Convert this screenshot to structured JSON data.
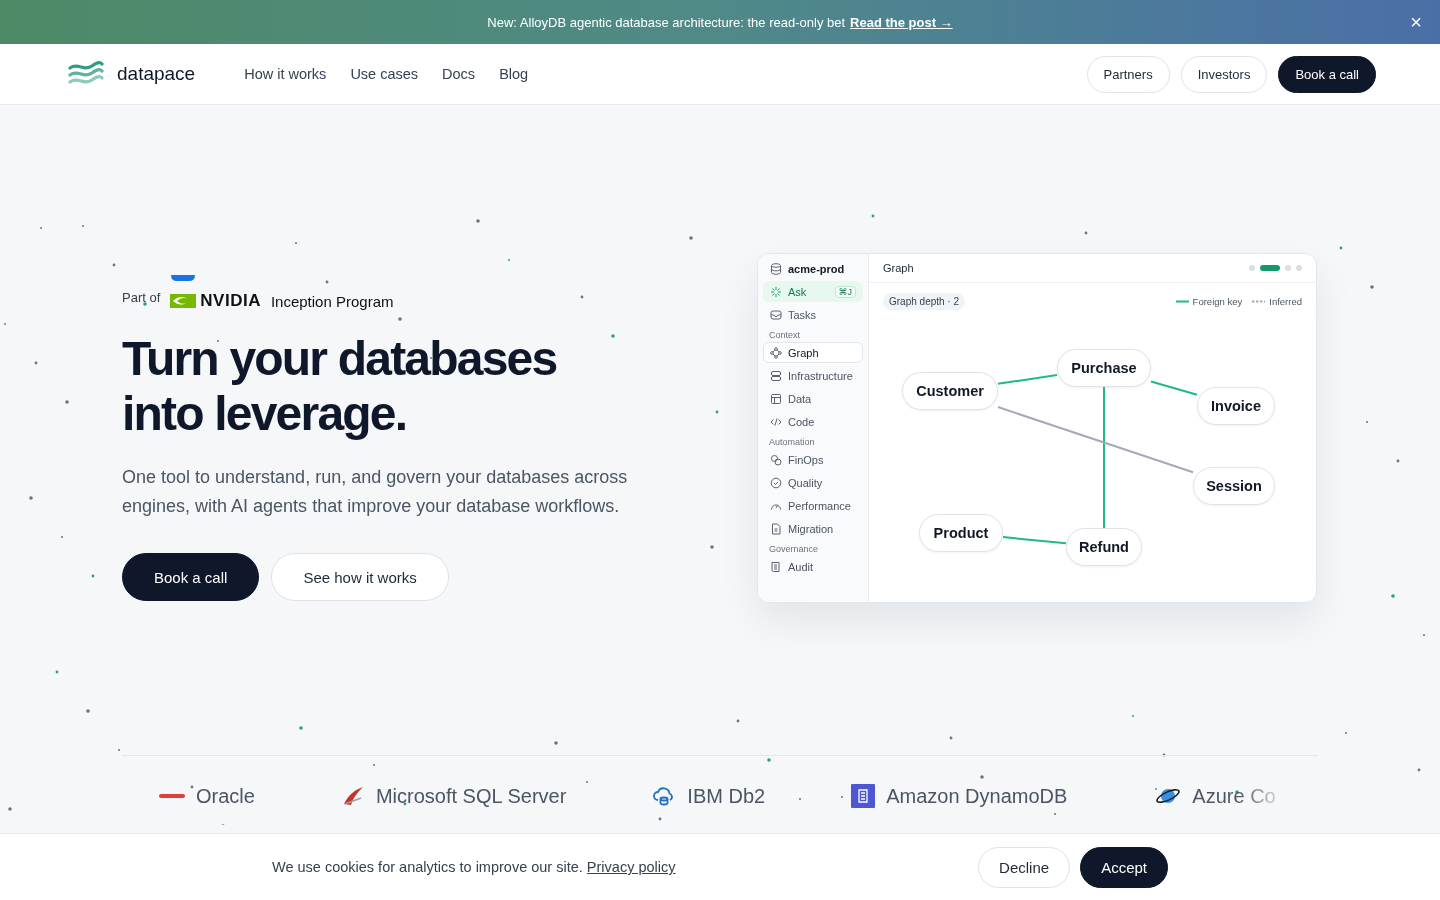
{
  "announcement": {
    "text": "New: AlloyDB agentic database architecture: the read-only bet",
    "link": "Read the post",
    "arrow": "→",
    "close": "×"
  },
  "nav": {
    "brand": "datapace",
    "links": [
      "How it works",
      "Use cases",
      "Docs",
      "Blog"
    ],
    "buttons": [
      {
        "label": "Partners",
        "kind": "outline"
      },
      {
        "label": "Investors",
        "kind": "outline"
      },
      {
        "label": "Book a call",
        "kind": "primary"
      }
    ]
  },
  "hero": {
    "part_of": "Part of",
    "partner_logo": "NVIDIA",
    "partner_program": "Inception Program",
    "title_lines": [
      "Turn your databases",
      "into leverage."
    ],
    "subtitle": "One tool to understand, run, and govern your databases across engines, with AI agents that improve your database workflows.",
    "buttons": [
      {
        "label": "Book a call",
        "kind": "primary"
      },
      {
        "label": "See how it works",
        "kind": "outline"
      }
    ]
  },
  "app_preview": {
    "sidebar": [
      {
        "kind": "workspace",
        "label": "acme-prod",
        "selected": false
      },
      {
        "kind": "action",
        "label": "Ask",
        "shortcut": "⌘J",
        "selected": false
      },
      {
        "kind": "item",
        "label": "Tasks",
        "selected": false
      },
      {
        "kind": "heading",
        "label": "Context"
      },
      {
        "kind": "item",
        "label": "Graph",
        "selected": true
      },
      {
        "kind": "item",
        "label": "Infrastructure",
        "selected": false
      },
      {
        "kind": "item",
        "label": "Data",
        "selected": false
      },
      {
        "kind": "item",
        "label": "Code",
        "selected": false
      },
      {
        "kind": "heading",
        "label": "Automation"
      },
      {
        "kind": "item",
        "label": "FinOps",
        "selected": false
      },
      {
        "kind": "item",
        "label": "Quality",
        "selected": false
      },
      {
        "kind": "item",
        "label": "Performance",
        "selected": false
      },
      {
        "kind": "item",
        "label": "Migration",
        "selected": false
      },
      {
        "kind": "heading",
        "label": "Governance"
      },
      {
        "kind": "item",
        "label": "Audit",
        "selected": false
      }
    ],
    "panel_title": "Graph",
    "pager": [
      {
        "selected": false
      },
      {
        "selected": true
      },
      {
        "selected": false
      },
      {
        "selected": false
      }
    ],
    "depth_chip": "Graph depth · 2",
    "legend": [
      {
        "kind": "foreign_key",
        "label": "Foreign key"
      },
      {
        "kind": "inferred",
        "label": "Inferred"
      }
    ],
    "nodes": [
      "Customer",
      "Purchase",
      "Invoice",
      "Session",
      "Product",
      "Refund"
    ],
    "edges": [
      {
        "kind": "foreign_key"
      },
      {
        "kind": "foreign_key"
      },
      {
        "kind": "foreign_key"
      },
      {
        "kind": "foreign_key"
      },
      {
        "kind": "inferred"
      }
    ]
  },
  "databases": [
    {
      "name": "Oracle"
    },
    {
      "name": "Microsoft SQL Server"
    },
    {
      "name": "IBM Db2"
    },
    {
      "name": "Amazon DynamoDB"
    },
    {
      "name": "Azure Co"
    }
  ],
  "cookie": {
    "text": "We use cookies for analytics to improve our site.",
    "link": "Privacy policy",
    "buttons": [
      {
        "label": "Decline",
        "kind": "outline"
      },
      {
        "label": "Accept",
        "kind": "primary"
      }
    ]
  }
}
